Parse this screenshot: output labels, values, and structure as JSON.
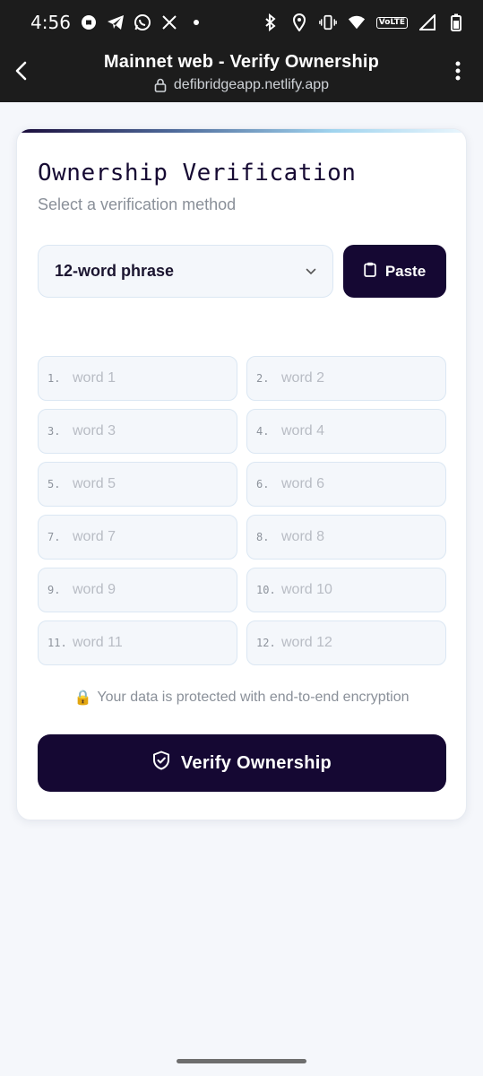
{
  "status_bar": {
    "time": "4:56",
    "volte_label": "VoLTE",
    "left_icons": [
      "notification-icon",
      "telegram-icon",
      "whatsapp-icon",
      "x-icon",
      "dot-icon"
    ],
    "right_icons": [
      "bluetooth-icon",
      "location-icon",
      "vibrate-icon",
      "wifi-icon",
      "signal-icon",
      "battery-icon"
    ]
  },
  "browser": {
    "title": "Mainnet web - Verify Ownership",
    "url": "defibridgeapp.netlify.app"
  },
  "card": {
    "title": "Ownership Verification",
    "subtitle": "Select a verification method",
    "method_select_value": "12-word phrase",
    "paste_label": "Paste",
    "words": [
      {
        "num": "1.",
        "placeholder": "word 1"
      },
      {
        "num": "2.",
        "placeholder": "word 2"
      },
      {
        "num": "3.",
        "placeholder": "word 3"
      },
      {
        "num": "4.",
        "placeholder": "word 4"
      },
      {
        "num": "5.",
        "placeholder": "word 5"
      },
      {
        "num": "6.",
        "placeholder": "word 6"
      },
      {
        "num": "7.",
        "placeholder": "word 7"
      },
      {
        "num": "8.",
        "placeholder": "word 8"
      },
      {
        "num": "9.",
        "placeholder": "word 9"
      },
      {
        "num": "10.",
        "placeholder": "word 10"
      },
      {
        "num": "11.",
        "placeholder": "word 11"
      },
      {
        "num": "12.",
        "placeholder": "word 12"
      }
    ],
    "security_emoji": "🔒",
    "security_note": "Your data is protected with end-to-end encryption",
    "verify_label": "Verify Ownership"
  },
  "colors": {
    "primary": "#150833",
    "muted_text": "#8a9099",
    "field_bg": "#f4f7fb",
    "field_border": "#dbe7f3"
  }
}
